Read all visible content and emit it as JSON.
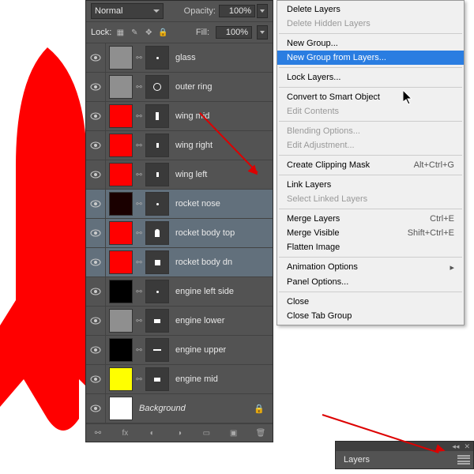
{
  "panel": {
    "blend_mode": "Normal",
    "opacity_label": "Opacity:",
    "opacity_value": "100%",
    "lock_label": "Lock:",
    "fill_label": "Fill:",
    "fill_value": "100%"
  },
  "layers": [
    {
      "name": "glass",
      "swatch": "#8f8f8f",
      "selected": false,
      "mask_shape": "dot"
    },
    {
      "name": "outer ring",
      "swatch": "#8f8f8f",
      "selected": false,
      "mask_shape": "ring"
    },
    {
      "name": "wing mid",
      "swatch": "#ff0000",
      "selected": false,
      "mask_shape": "wing"
    },
    {
      "name": "wing right",
      "swatch": "#ff0000",
      "selected": false,
      "mask_shape": "small"
    },
    {
      "name": "wing left",
      "swatch": "#ff0000",
      "selected": false,
      "mask_shape": "small"
    },
    {
      "name": "rocket nose",
      "swatch": "#1a0000",
      "selected": true,
      "mask_shape": "dot"
    },
    {
      "name": "rocket body top",
      "swatch": "#ff0000",
      "selected": true,
      "mask_shape": "body"
    },
    {
      "name": "rocket body dn",
      "swatch": "#ff0000",
      "selected": true,
      "mask_shape": "square"
    },
    {
      "name": "engine left side",
      "swatch": "#000000",
      "selected": false,
      "mask_shape": "dot"
    },
    {
      "name": "engine lower",
      "swatch": "#8f8f8f",
      "selected": false,
      "mask_shape": "trap"
    },
    {
      "name": "engine upper",
      "swatch": "#000000",
      "selected": false,
      "mask_shape": "line"
    },
    {
      "name": "engine mid",
      "swatch": "#ffff00",
      "selected": false,
      "mask_shape": "trap"
    }
  ],
  "background_layer": {
    "name": "Background",
    "swatch": "#ffffff"
  },
  "menu": [
    {
      "label": "Delete Layers",
      "disabled": false
    },
    {
      "label": "Delete Hidden Layers",
      "disabled": true
    },
    {
      "sep": true
    },
    {
      "label": "New Group...",
      "disabled": false
    },
    {
      "label": "New Group from Layers...",
      "disabled": false,
      "highlighted": true
    },
    {
      "sep": true
    },
    {
      "label": "Lock Layers...",
      "disabled": false
    },
    {
      "sep": true
    },
    {
      "label": "Convert to Smart Object",
      "disabled": false
    },
    {
      "label": "Edit Contents",
      "disabled": true
    },
    {
      "sep": true
    },
    {
      "label": "Blending Options...",
      "disabled": true
    },
    {
      "label": "Edit Adjustment...",
      "disabled": true
    },
    {
      "sep": true
    },
    {
      "label": "Create Clipping Mask",
      "shortcut": "Alt+Ctrl+G",
      "disabled": false
    },
    {
      "sep": true
    },
    {
      "label": "Link Layers",
      "disabled": false
    },
    {
      "label": "Select Linked Layers",
      "disabled": true
    },
    {
      "sep": true
    },
    {
      "label": "Merge Layers",
      "shortcut": "Ctrl+E",
      "disabled": false
    },
    {
      "label": "Merge Visible",
      "shortcut": "Shift+Ctrl+E",
      "disabled": false
    },
    {
      "label": "Flatten Image",
      "disabled": false
    },
    {
      "sep": true
    },
    {
      "label": "Animation Options",
      "submenu": true,
      "disabled": false
    },
    {
      "label": "Panel Options...",
      "disabled": false
    },
    {
      "sep": true
    },
    {
      "label": "Close",
      "disabled": false
    },
    {
      "label": "Close Tab Group",
      "disabled": false
    }
  ],
  "tab": {
    "label": "Layers"
  }
}
